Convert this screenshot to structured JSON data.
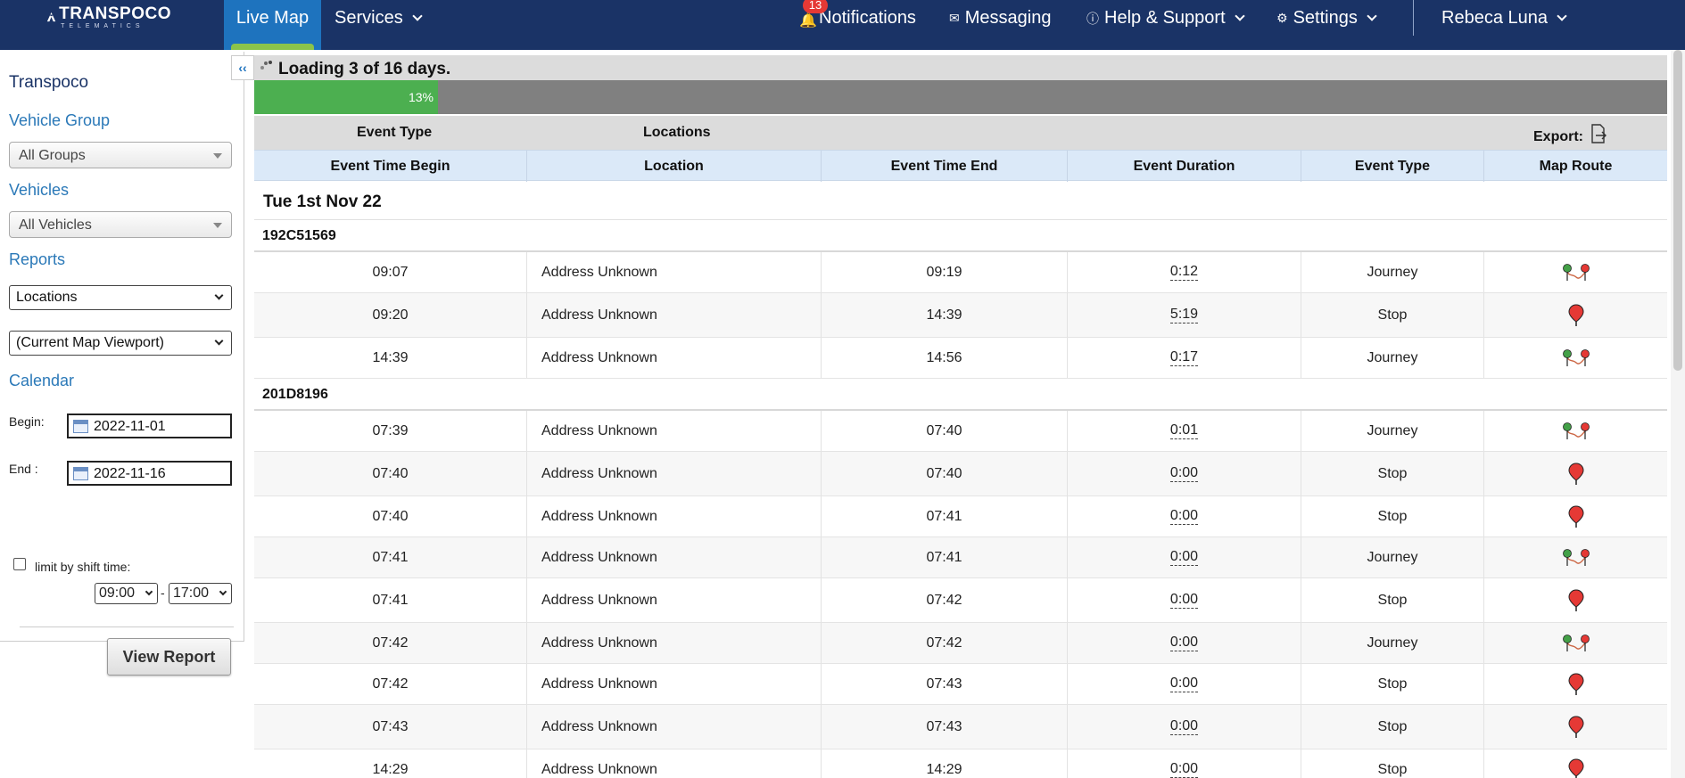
{
  "brand": {
    "name": "TRANSPOCO",
    "tagline": "TELEMATICS"
  },
  "nav": {
    "live_map": "Live Map",
    "services": "Services",
    "notifications": "Notifications",
    "notifications_count": "13",
    "messaging": "Messaging",
    "help": "Help & Support",
    "settings": "Settings",
    "user": "Rebeca Luna"
  },
  "sidebar": {
    "collapse": "‹‹",
    "company": "Transpoco",
    "vehicle_group_label": "Vehicle Group",
    "vehicle_group_value": "All Groups",
    "vehicles_label": "Vehicles",
    "vehicles_value": "All Vehicles",
    "reports_label": "Reports",
    "report_value": "Locations",
    "viewport_value": "(Current Map Viewport)",
    "calendar_label": "Calendar",
    "begin_label": "Begin:",
    "begin_value": "2022-11-01",
    "end_label": "End :",
    "end_value": "2022-11-16",
    "limit_label": "limit by shift time:",
    "shift_start": "09:00",
    "shift_sep": "-",
    "shift_end": "17:00",
    "view_report": "View Report"
  },
  "main": {
    "loading_text": "Loading 3 of 16 days.",
    "progress": 0.13,
    "progress_label": "13%",
    "filter_event_type": "Event Type",
    "filter_locations": "Locations",
    "export_label": "Export:",
    "columns": [
      "Event Time Begin",
      "Location",
      "Event Time End",
      "Event Duration",
      "Event Type",
      "Map Route"
    ],
    "day_label": "Tue 1st Nov 22",
    "groups": [
      {
        "vehicle": "192C51569",
        "rows": [
          {
            "begin": "09:07",
            "location": "Address Unknown",
            "end": "09:19",
            "duration": "0:12",
            "type": "Journey",
            "route": "route"
          },
          {
            "begin": "09:20",
            "location": "Address Unknown",
            "end": "14:39",
            "duration": "5:19",
            "type": "Stop",
            "route": "pin"
          },
          {
            "begin": "14:39",
            "location": "Address Unknown",
            "end": "14:56",
            "duration": "0:17",
            "type": "Journey",
            "route": "route"
          }
        ]
      },
      {
        "vehicle": "201D8196",
        "rows": [
          {
            "begin": "07:39",
            "location": "Address Unknown",
            "end": "07:40",
            "duration": "0:01",
            "type": "Journey",
            "route": "route"
          },
          {
            "begin": "07:40",
            "location": "Address Unknown",
            "end": "07:40",
            "duration": "0:00",
            "type": "Stop",
            "route": "pin"
          },
          {
            "begin": "07:40",
            "location": "Address Unknown",
            "end": "07:41",
            "duration": "0:00",
            "type": "Stop",
            "route": "pin"
          },
          {
            "begin": "07:41",
            "location": "Address Unknown",
            "end": "07:41",
            "duration": "0:00",
            "type": "Journey",
            "route": "route"
          },
          {
            "begin": "07:41",
            "location": "Address Unknown",
            "end": "07:42",
            "duration": "0:00",
            "type": "Stop",
            "route": "pin"
          },
          {
            "begin": "07:42",
            "location": "Address Unknown",
            "end": "07:42",
            "duration": "0:00",
            "type": "Journey",
            "route": "route"
          },
          {
            "begin": "07:42",
            "location": "Address Unknown",
            "end": "07:43",
            "duration": "0:00",
            "type": "Stop",
            "route": "pin"
          },
          {
            "begin": "07:43",
            "location": "Address Unknown",
            "end": "07:43",
            "duration": "0:00",
            "type": "Stop",
            "route": "pin"
          },
          {
            "begin": "14:29",
            "location": "Address Unknown",
            "end": "14:29",
            "duration": "0:00",
            "type": "Stop",
            "route": "pin"
          }
        ]
      }
    ]
  },
  "colors": {
    "nav_bg": "#1a3366",
    "active_tab": "#1e73be",
    "progress_fill": "#4caf50",
    "link": "#2b79b8"
  }
}
